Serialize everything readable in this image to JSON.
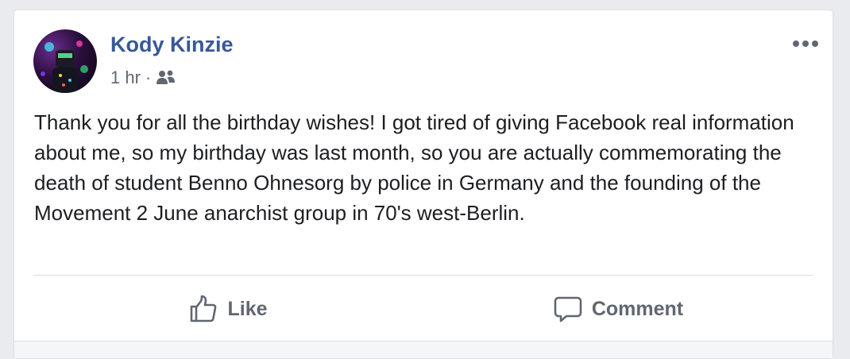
{
  "post": {
    "author": "Kody Kinzie",
    "time": "1 hr",
    "separator": "·",
    "audience_icon": "friends-icon",
    "text": "Thank you for all the birthday wishes! I got tired of giving Facebook real information about me, so my birthday was last month, so you are actually commemorating the death of student Benno Ohnesorg by police in Germany and the founding of the Movement 2 June anarchist group in 70's west-Berlin.",
    "more_icon": "more-options-icon"
  },
  "actions": {
    "like_label": "Like",
    "like_icon": "thumbs-up-icon",
    "comment_label": "Comment",
    "comment_icon": "comment-icon"
  },
  "colors": {
    "author": "#385898",
    "text": "#1c1e21",
    "secondary": "#606770",
    "background": "#e9ebee",
    "card": "#ffffff"
  }
}
